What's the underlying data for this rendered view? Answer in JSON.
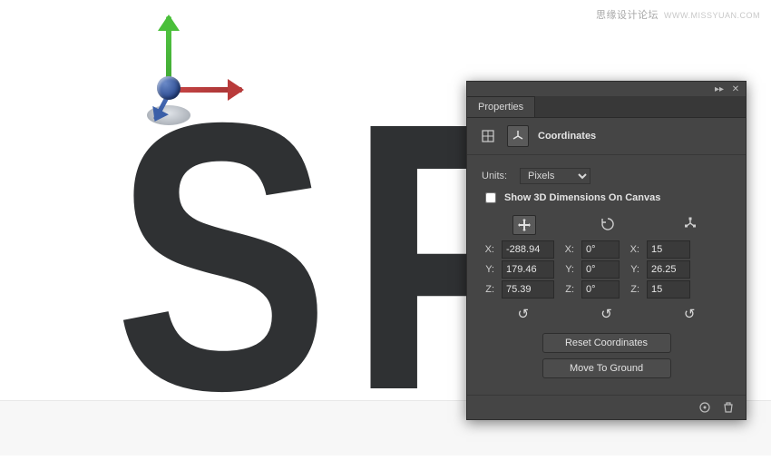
{
  "watermark": {
    "text": "思缘设计论坛",
    "url": "WWW.MISSYUAN.COM"
  },
  "letters": [
    "S",
    "P"
  ],
  "panel": {
    "tab": "Properties",
    "section": "Coordinates",
    "units_label": "Units:",
    "units_value": "Pixels",
    "show3d": "Show 3D Dimensions On Canvas",
    "pos": {
      "x": "-288.94",
      "y": "179.46",
      "z": "75.39"
    },
    "rot": {
      "x": "0°",
      "y": "0°",
      "z": "0°"
    },
    "scl": {
      "x": "15",
      "y": "26.25",
      "z": "15"
    },
    "reset_btn": "Reset Coordinates",
    "ground_btn": "Move To Ground"
  }
}
